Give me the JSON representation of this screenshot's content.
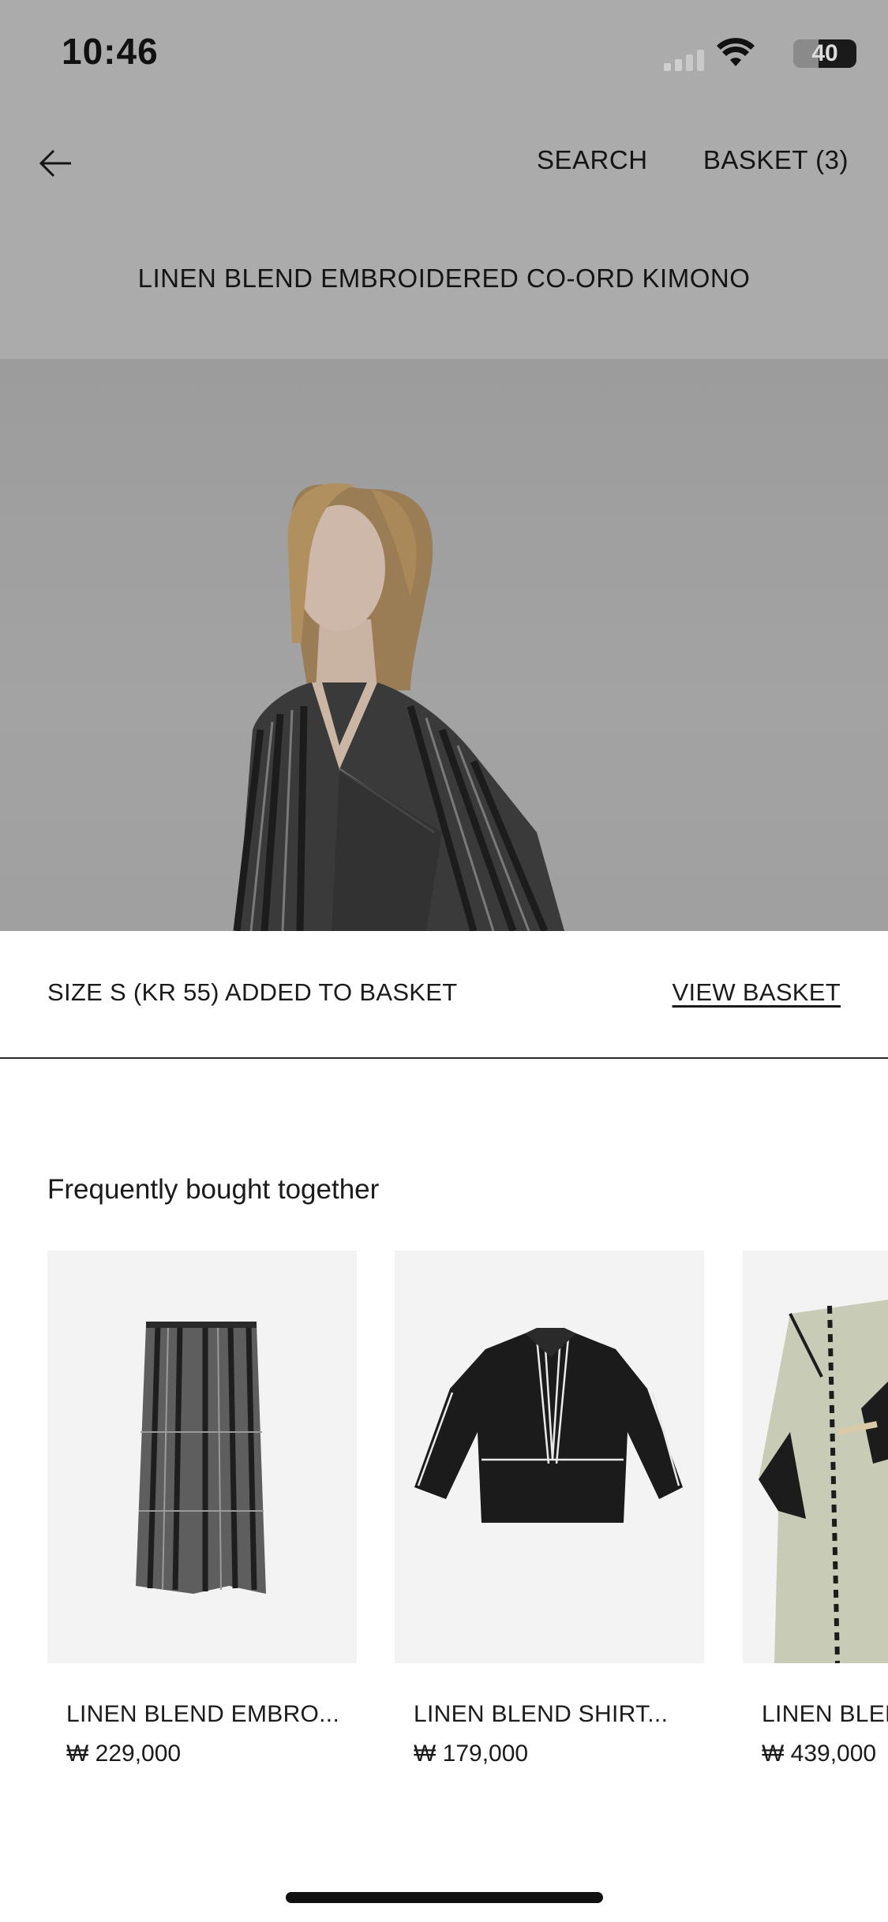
{
  "status_bar": {
    "time": "10:46",
    "battery": "40",
    "battery_level": 0.4
  },
  "header": {
    "search_label": "SEARCH",
    "basket_label": "BASKET (3)",
    "back_icon": "arrow-left-icon"
  },
  "product": {
    "title": "LINEN BLEND EMBROIDERED CO-ORD KIMONO"
  },
  "notification": {
    "message": "SIZE S (KR 55) ADDED TO BASKET",
    "action_label": "VIEW BASKET"
  },
  "recommendations": {
    "title": "Frequently bought together",
    "items": [
      {
        "name": "LINEN BLEND EMBRO...",
        "price": "₩ 229,000"
      },
      {
        "name": "LINEN BLEND SHIRT...",
        "price": "₩ 179,000"
      },
      {
        "name": "LINEN BLEND",
        "price": "₩ 439,000"
      }
    ]
  },
  "colors": {
    "overlay": "#ababab",
    "text": "#1b1b1b"
  }
}
